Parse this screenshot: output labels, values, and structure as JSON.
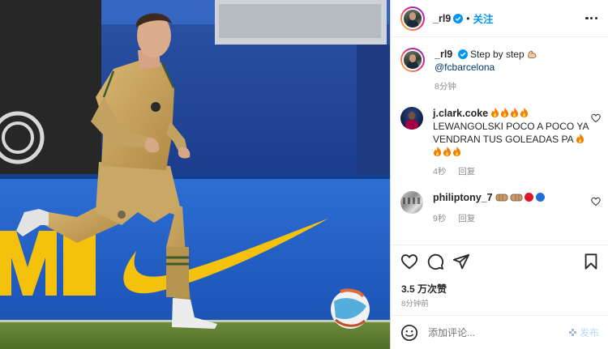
{
  "post": {
    "author": "_rl9",
    "follow_label": "关注",
    "caption": {
      "username": "_rl9",
      "text": "Step by step",
      "mention": "@fcbarcelona",
      "time": "8分钟"
    },
    "comments": [
      {
        "username": "j.clark.coke",
        "username_fire_count": 4,
        "text": "LEWANGOLSKI POCO A POCO YA VENDRAN TUS GOLEADAS PA",
        "time": "4秒",
        "reply_label": "回复"
      },
      {
        "username": "philiptony_7",
        "time": "9秒",
        "reply_label": "回复"
      }
    ],
    "likes": "3.5 万次赞",
    "posted_ago": "8分钟前",
    "comment_placeholder": "添加评论...",
    "post_label": "发布"
  },
  "colors": {
    "accent": "#0095f6",
    "post_disabled": "#b3dbff",
    "jersey": "#c7a35f",
    "nike_swoosh": "#f4c20d"
  }
}
